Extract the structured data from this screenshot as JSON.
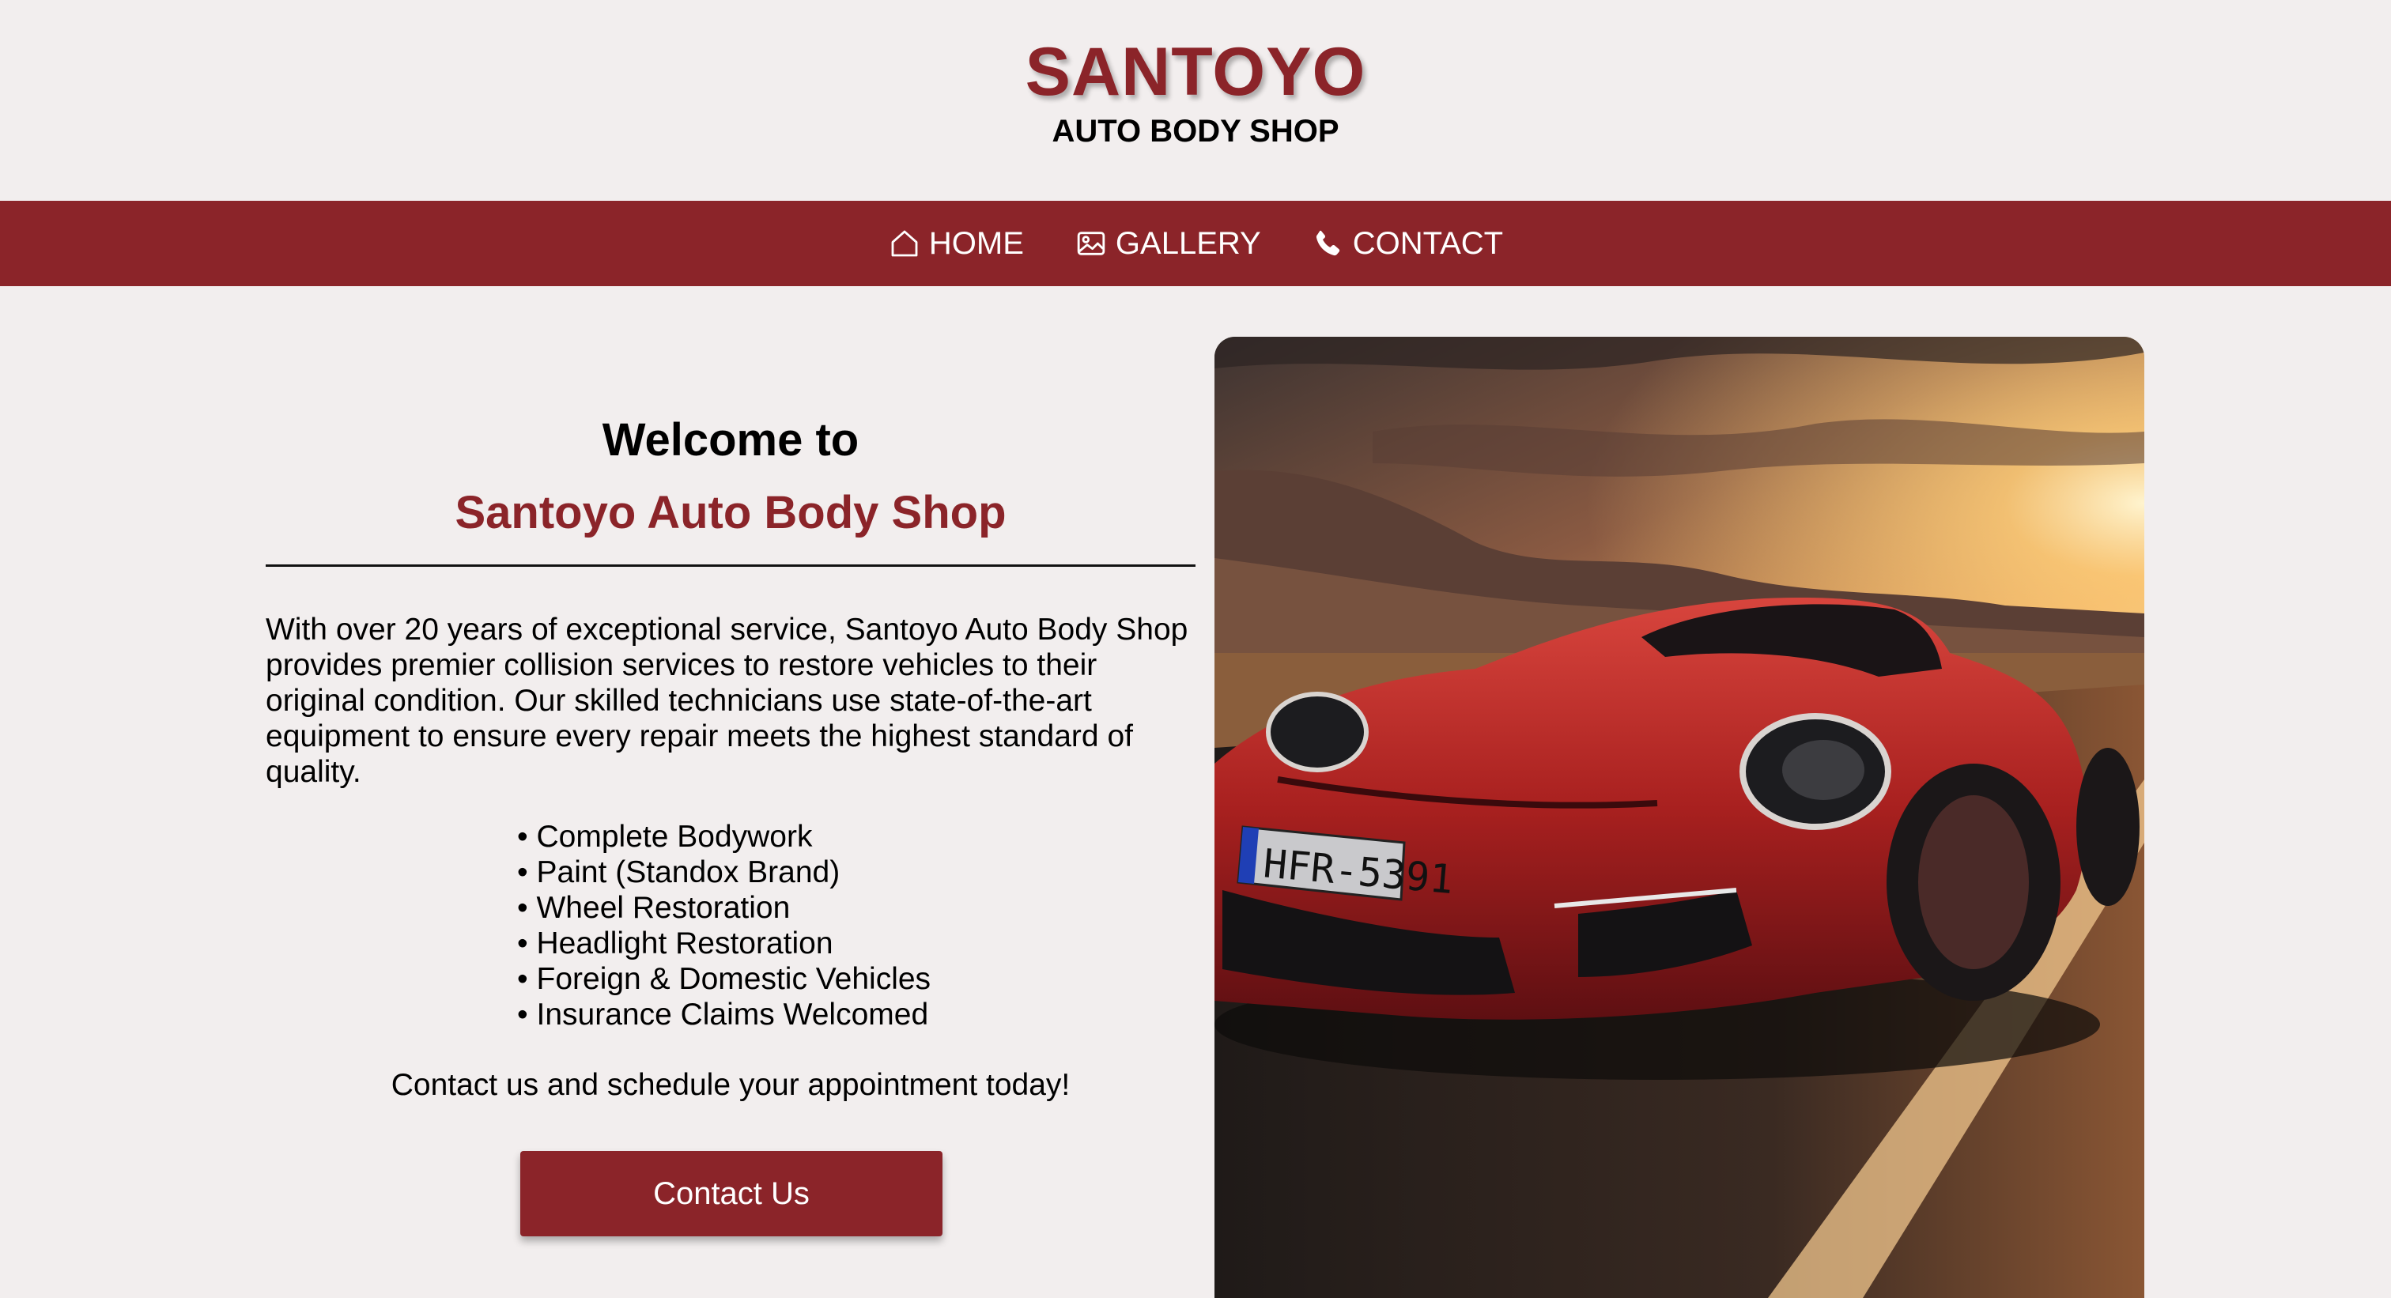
{
  "header": {
    "title": "SANTOYO",
    "subtitle": "AUTO BODY SHOP"
  },
  "nav": {
    "items": [
      {
        "label": "HOME",
        "icon": "home-icon"
      },
      {
        "label": "GALLERY",
        "icon": "image-icon"
      },
      {
        "label": "CONTACT",
        "icon": "phone-icon"
      }
    ]
  },
  "intro": {
    "welcome": "Welcome to",
    "shop_name": "Santoyo Auto Body Shop",
    "description": "With over 20 years of exceptional service, Santoyo Auto Body Shop provides premier collision services to restore vehicles to their original condition. Our skilled technicians use state-of-the-art equipment to ensure every repair meets the highest standard of quality.",
    "services": [
      "Complete Bodywork",
      "Paint (Standox Brand)",
      "Wheel Restoration",
      "Headlight Restoration",
      "Foreign & Domestic Vehicles",
      "Insurance Claims Welcomed"
    ],
    "cta_text": "Contact us and schedule your appointment today!",
    "cta_button": "Contact Us"
  },
  "hero": {
    "plate": "HFR-5391"
  },
  "colors": {
    "brand": "#8b2429",
    "background": "#f2eeee",
    "nav_text": "#ffffff"
  }
}
